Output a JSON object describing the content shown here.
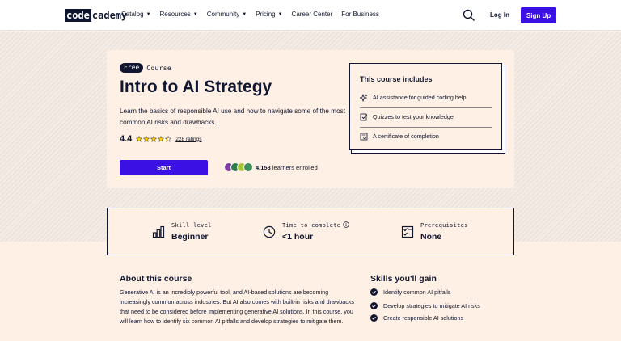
{
  "nav": {
    "logo_code": "code",
    "logo_rest": "cademy",
    "menu": [
      {
        "label": "Catalog",
        "has_caret": true
      },
      {
        "label": "Resources",
        "has_caret": true
      },
      {
        "label": "Community",
        "has_caret": true
      },
      {
        "label": "Pricing",
        "has_caret": true
      },
      {
        "label": "Career Center",
        "has_caret": false
      },
      {
        "label": "For Business",
        "has_caret": false
      }
    ],
    "login": "Log In",
    "signup": "Sign Up",
    "search_icon": "search-icon"
  },
  "hero": {
    "badge": "Free",
    "type": "Course",
    "title": "Intro to AI Strategy",
    "description": "Learn the basics of responsible AI use and how to navigate some of the most common AI risks and drawbacks.",
    "rating": "4.4",
    "rating_stars": 4.4,
    "ratings_count": "228 ratings",
    "start_button": "Start",
    "learners_count": "4,153",
    "learners_suffix": "learners enrolled"
  },
  "includes": {
    "title": "This course includes",
    "items": [
      {
        "icon": "sparkle-icon",
        "label": "AI assistance for guided coding help"
      },
      {
        "icon": "quiz-icon",
        "label": "Quizzes to test your knowledge"
      },
      {
        "icon": "certificate-icon",
        "label": "A certificate of completion"
      }
    ]
  },
  "stats": {
    "skill": {
      "label": "Skill level",
      "value": "Beginner",
      "icon": "bar-chart-icon"
    },
    "time": {
      "label": "Time to complete",
      "value": "<1 hour",
      "icon": "clock-icon"
    },
    "prereq": {
      "label": "Prerequisites",
      "value": "None",
      "icon": "checklist-icon"
    }
  },
  "about": {
    "heading": "About this course",
    "body": "Generative AI is an incredibly powerful tool, and AI-based solutions are becoming increasingly common across industries. But AI also comes with built-in risks and drawbacks that need to be considered before implementing generative AI solutions. In this course, you will learn how to identify six common AI pitfalls and develop strategies to mitigate them."
  },
  "skills": {
    "heading": "Skills you'll gain",
    "items": [
      "Identify common AI pitfalls",
      "Develop strategies to mitigate AI risks",
      "Create responsible AI solutions"
    ]
  },
  "colors": {
    "brand_navy": "#10162f",
    "brand_blue": "#3a10e5",
    "star_yellow": "#ffd300",
    "bg_beige": "#fff0e5"
  }
}
